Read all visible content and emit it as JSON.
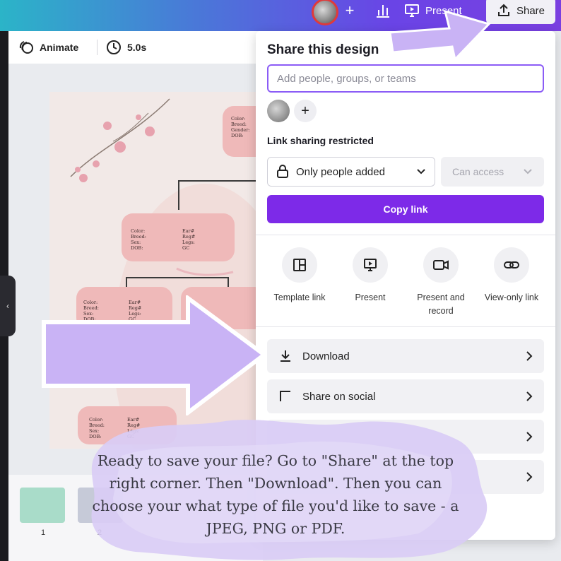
{
  "topbar": {
    "present_label": "Present",
    "share_label": "Share"
  },
  "toolbar": {
    "animate_label": "Animate",
    "duration_label": "5.0s"
  },
  "canvas": {
    "card_top": "Color:\nBreed:\nGender:\nDOB:",
    "card_mid_left": "Color:\nBreed:\nSex:\nDOB:",
    "card_mid_right": "Ear#\nReg#\nLegs:\nGC",
    "card_small_left": "Color:\nBreed:\nSex:\nDOB:",
    "card_small_right": "Ear#\nReg#\nLegs:\nGC"
  },
  "pages": {
    "thumbs": [
      {
        "number": "1",
        "color": "#a9dcc9"
      },
      {
        "number": "2",
        "color": "#c6cad8"
      }
    ]
  },
  "share_panel": {
    "title": "Share this design",
    "people_placeholder": "Add people, groups, or teams",
    "link_sharing_label": "Link sharing restricted",
    "access_value": "Only people added",
    "can_access_value": "Can access",
    "copy_link_label": "Copy link",
    "options": [
      {
        "label": "Template link",
        "icon": "template-icon"
      },
      {
        "label": "Present",
        "icon": "present-icon"
      },
      {
        "label": "Present and record",
        "icon": "camera-icon"
      },
      {
        "label": "View-only link",
        "icon": "link-icon"
      }
    ],
    "rows": [
      {
        "label": "Download",
        "icon": "download-icon"
      },
      {
        "label": "Share on social",
        "icon": "social-icon"
      },
      {
        "label": "",
        "icon": ""
      },
      {
        "label": "",
        "icon": ""
      }
    ]
  },
  "caption": {
    "line1": "Ready to save your file? Go to \"Share\" at the top",
    "line2": "right corner. Then \"Download\". Then you can",
    "line3": "choose your what type of file you'd like to save - a",
    "line4": "JPEG, PNG or PDF."
  },
  "colors": {
    "accent": "#7d2ae8",
    "arrow": "#c9b3f5",
    "card_pink": "#efb9b9"
  }
}
